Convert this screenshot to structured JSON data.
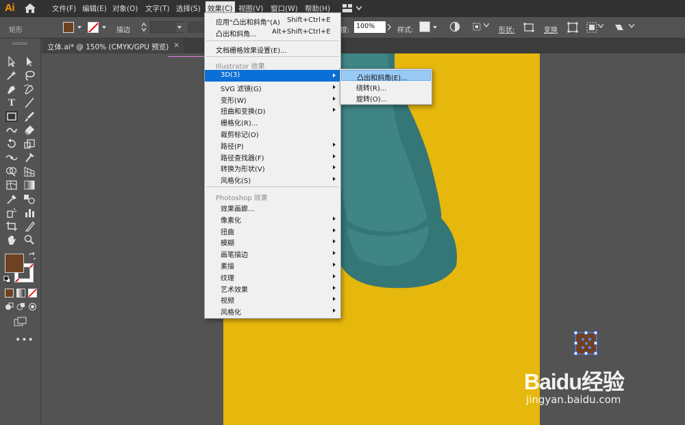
{
  "app": {
    "logo": "Ai"
  },
  "menubar": {
    "items": [
      "文件(F)",
      "编辑(E)",
      "对象(O)",
      "文字(T)",
      "选择(S)",
      "效果(C)",
      "视图(V)",
      "窗口(W)",
      "帮助(H)"
    ],
    "active": "效果(C)"
  },
  "controlbar": {
    "shape_label": "矩形",
    "stroke_label": "描边",
    "opacity_label": "度:",
    "opacity_value": "100%",
    "style_label": "样式:",
    "shape_props_label": "形状:",
    "transform_label": "变换"
  },
  "colors": {
    "fill": "#6e4123",
    "artboard": "#e6b70c",
    "teal": "#3f8585",
    "teal_dark": "#357676",
    "highlight": "#0a6fd6"
  },
  "document": {
    "tab_title": "立体.ai* @ 150% (CMYK/GPU 预览)",
    "close_glyph": "×"
  },
  "effect_menu": {
    "apply_last": {
      "label": "应用\"凸出和斜角\"(A)",
      "shortcut": "Shift+Ctrl+E"
    },
    "last_effect": {
      "label": "凸出和斜角...",
      "shortcut": "Alt+Shift+Ctrl+E"
    },
    "doc_raster": "文档栅格效果设置(E)...",
    "illustrator_header": "Illustrator 效果",
    "illustrator_items": [
      {
        "label": "3D(3)",
        "submenu": true,
        "highlighted": true
      },
      {
        "label": "SVG 滤镜(G)",
        "submenu": true
      },
      {
        "label": "变形(W)",
        "submenu": true
      },
      {
        "label": "扭曲和变换(D)",
        "submenu": true
      },
      {
        "label": "栅格化(R)...",
        "submenu": false
      },
      {
        "label": "裁剪标记(O)",
        "submenu": false
      },
      {
        "label": "路径(P)",
        "submenu": true
      },
      {
        "label": "路径查找器(F)",
        "submenu": true
      },
      {
        "label": "转换为形状(V)",
        "submenu": true
      },
      {
        "label": "风格化(S)",
        "submenu": true
      }
    ],
    "photoshop_header": "Photoshop 效果",
    "photoshop_items": [
      {
        "label": "效果画廊...",
        "submenu": false
      },
      {
        "label": "像素化",
        "submenu": true
      },
      {
        "label": "扭曲",
        "submenu": true
      },
      {
        "label": "模糊",
        "submenu": true
      },
      {
        "label": "画笔描边",
        "submenu": true
      },
      {
        "label": "素描",
        "submenu": true
      },
      {
        "label": "纹理",
        "submenu": true
      },
      {
        "label": "艺术效果",
        "submenu": true
      },
      {
        "label": "视频",
        "submenu": true
      },
      {
        "label": "风格化",
        "submenu": true
      }
    ]
  },
  "submenu_3d": {
    "items": [
      {
        "label": "凸出和斜角(E)...",
        "highlighted": true
      },
      {
        "label": "绕转(R)..."
      },
      {
        "label": "旋转(O)..."
      }
    ]
  },
  "watermark": {
    "main": "Baidu经验",
    "sub": "jingyan.baidu.com"
  }
}
